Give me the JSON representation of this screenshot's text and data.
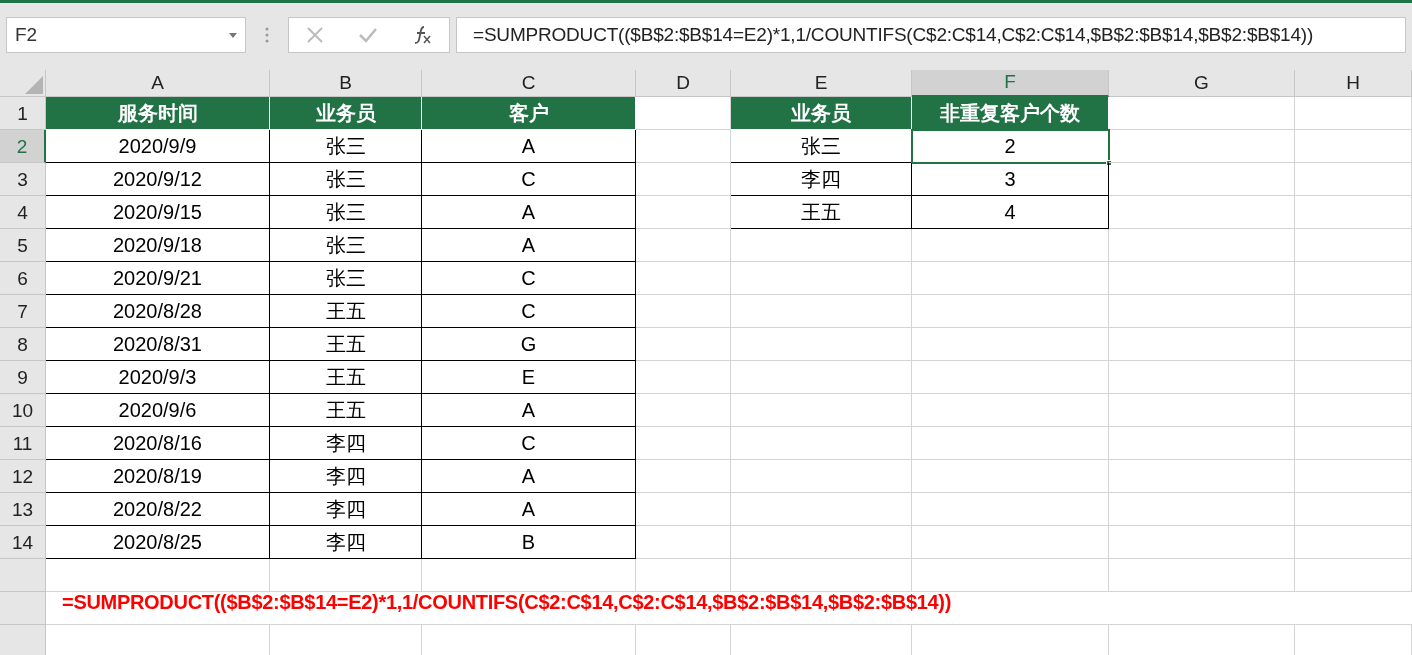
{
  "name_box": "F2",
  "formula": "=SUMPRODUCT(($B$2:$B$14=E2)*1,1/COUNTIFS(C$2:C$14,C$2:C$14,$B$2:$B$14,$B$2:$B$14))",
  "columns": [
    {
      "label": "A",
      "selected": false
    },
    {
      "label": "B",
      "selected": false
    },
    {
      "label": "C",
      "selected": false
    },
    {
      "label": "D",
      "selected": false
    },
    {
      "label": "E",
      "selected": false
    },
    {
      "label": "F",
      "selected": true
    },
    {
      "label": "G",
      "selected": false
    },
    {
      "label": "H",
      "selected": false
    }
  ],
  "rows": [
    {
      "number": "1",
      "kind": "header",
      "selected": false,
      "cells": {
        "A": "服务时间",
        "B": "业务员",
        "C": "客户",
        "E": "业务员",
        "F": "非重复客户个数"
      }
    },
    {
      "number": "2",
      "kind": "data",
      "selected": true,
      "cells": {
        "A": "2020/9/9",
        "B": "张三",
        "C": "A",
        "E": "张三",
        "F": "2"
      }
    },
    {
      "number": "3",
      "kind": "data",
      "selected": false,
      "cells": {
        "A": "2020/9/12",
        "B": "张三",
        "C": "C",
        "E": "李四",
        "F": "3"
      }
    },
    {
      "number": "4",
      "kind": "data",
      "selected": false,
      "cells": {
        "A": "2020/9/15",
        "B": "张三",
        "C": "A",
        "E": "王五",
        "F": "4"
      }
    },
    {
      "number": "5",
      "kind": "data",
      "selected": false,
      "cells": {
        "A": "2020/9/18",
        "B": "张三",
        "C": "A"
      }
    },
    {
      "number": "6",
      "kind": "data",
      "selected": false,
      "cells": {
        "A": "2020/9/21",
        "B": "张三",
        "C": "C"
      }
    },
    {
      "number": "7",
      "kind": "data",
      "selected": false,
      "cells": {
        "A": "2020/8/28",
        "B": "王五",
        "C": "C"
      }
    },
    {
      "number": "8",
      "kind": "data",
      "selected": false,
      "cells": {
        "A": "2020/8/31",
        "B": "王五",
        "C": "G"
      }
    },
    {
      "number": "9",
      "kind": "data",
      "selected": false,
      "cells": {
        "A": "2020/9/3",
        "B": "王五",
        "C": "E"
      }
    },
    {
      "number": "10",
      "kind": "data",
      "selected": false,
      "cells": {
        "A": "2020/9/6",
        "B": "王五",
        "C": "A"
      }
    },
    {
      "number": "11",
      "kind": "data",
      "selected": false,
      "cells": {
        "A": "2020/8/16",
        "B": "李四",
        "C": "C"
      }
    },
    {
      "number": "12",
      "kind": "data",
      "selected": false,
      "cells": {
        "A": "2020/8/19",
        "B": "李四",
        "C": "A"
      }
    },
    {
      "number": "13",
      "kind": "data",
      "selected": false,
      "cells": {
        "A": "2020/8/22",
        "B": "李四",
        "C": "A"
      }
    },
    {
      "number": "14",
      "kind": "data",
      "selected": false,
      "cells": {
        "A": "2020/8/25",
        "B": "李四",
        "C": "B"
      }
    }
  ],
  "note": "=SUMPRODUCT(($B$2:$B$14=E2)*1,1/COUNTIFS(C$2:C$14,C$2:C$14,$B$2:$B$14,$B$2:$B$14))"
}
